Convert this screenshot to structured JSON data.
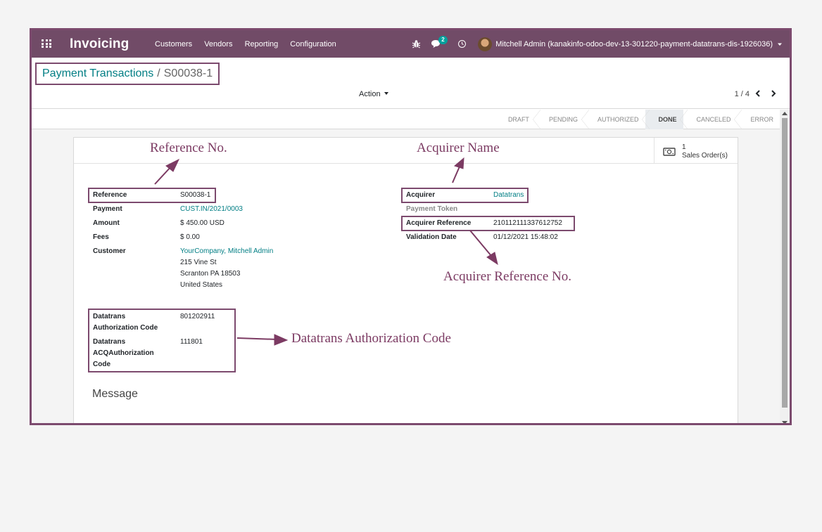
{
  "navbar": {
    "brand": "Invoicing",
    "menu": [
      "Customers",
      "Vendors",
      "Reporting",
      "Configuration"
    ],
    "chat_count": "2",
    "user": "Mitchell Admin (kanakinfo-odoo-dev-13-301220-payment-datatrans-dis-1926036)"
  },
  "breadcrumb": {
    "parent": "Payment Transactions",
    "separator": "/",
    "current": "S00038-1"
  },
  "control": {
    "action_label": "Action",
    "pager": "1 / 4"
  },
  "statusbar": {
    "steps": [
      "DRAFT",
      "PENDING",
      "AUTHORIZED",
      "DONE",
      "CANCELED",
      "ERROR"
    ],
    "active": "DONE"
  },
  "smart_button": {
    "count": "1",
    "label": "Sales Order(s)"
  },
  "left_fields": {
    "reference_label": "Reference",
    "reference_value": "S00038-1",
    "payment_label": "Payment",
    "payment_value": "CUST.IN/2021/0003",
    "amount_label": "Amount",
    "amount_value": "$ 450.00",
    "amount_currency": "USD",
    "fees_label": "Fees",
    "fees_value": "$ 0.00",
    "customer_label": "Customer",
    "customer_name": "YourCompany, Mitchell Admin",
    "customer_street": "215 Vine St",
    "customer_city": "Scranton PA 18503",
    "customer_country": "United States"
  },
  "right_fields": {
    "acquirer_label": "Acquirer",
    "acquirer_value": "Datatrans",
    "token_label": "Payment Token",
    "acq_ref_label": "Acquirer Reference",
    "acq_ref_value": "210112111337612752",
    "validation_label": "Validation Date",
    "validation_value": "01/12/2021 15:48:02"
  },
  "datatrans_fields": {
    "auth_label_1": "Datatrans",
    "auth_label_2": "Authorization Code",
    "auth_value": "801202911",
    "acq_auth_label_1": "Datatrans",
    "acq_auth_label_2": "ACQAuthorization",
    "acq_auth_label_3": "Code",
    "acq_auth_value": "111801"
  },
  "message_title": "Message",
  "annotations": {
    "reference": "Reference No.",
    "acquirer": "Acquirer Name",
    "acquirer_reference": "Acquirer Reference No.",
    "datatrans": "Datatrans Authorization Code"
  },
  "colors": {
    "navbar": "#714b67",
    "link": "#017e84",
    "highlight": "#7c4a6e",
    "annotation": "#7c3b63"
  }
}
